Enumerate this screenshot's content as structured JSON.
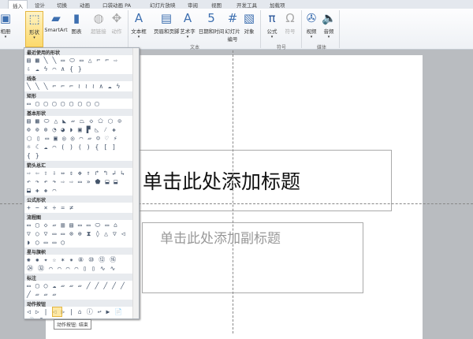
{
  "tabs": [
    "插入",
    "设计",
    "切换",
    "动画",
    "口袋动画 PA",
    "幻灯片放映",
    "审阅",
    "视图",
    "开发工具",
    "加载项"
  ],
  "ribbon": {
    "items": [
      {
        "label": "相册",
        "icon": "photo-album-icon",
        "glyph": "▣"
      },
      {
        "label": "形状",
        "icon": "shapes-icon",
        "glyph": "⬚"
      },
      {
        "label": "SmartArt",
        "icon": "smartart-icon",
        "glyph": "▰"
      },
      {
        "label": "图表",
        "icon": "chart-icon",
        "glyph": "▮"
      },
      {
        "label": "超链接",
        "icon": "hyperlink-icon",
        "glyph": "◍"
      },
      {
        "label": "动作",
        "icon": "action-icon",
        "glyph": "✥"
      },
      {
        "label": "文本框",
        "icon": "textbox-icon",
        "glyph": "A"
      },
      {
        "label": "页眉和页脚",
        "icon": "header-footer-icon",
        "glyph": "▤"
      },
      {
        "label": "艺术字",
        "icon": "wordart-icon",
        "glyph": "A"
      },
      {
        "label": "日期和时间",
        "icon": "date-time-icon",
        "glyph": "5"
      },
      {
        "label": "幻灯片\n编号",
        "icon": "slide-number-icon",
        "glyph": "#"
      },
      {
        "label": "对象",
        "icon": "object-icon",
        "glyph": "▧"
      },
      {
        "label": "公式",
        "icon": "equation-icon",
        "glyph": "π"
      },
      {
        "label": "符号",
        "icon": "symbol-icon",
        "glyph": "Ω"
      },
      {
        "label": "视频",
        "icon": "video-icon",
        "glyph": "✇"
      },
      {
        "label": "音频",
        "icon": "audio-icon",
        "glyph": "🔈"
      }
    ],
    "groups": [
      "文本",
      "符号",
      "媒体"
    ]
  },
  "gallery": {
    "sections": [
      {
        "title": "最近使用的形状",
        "shapes": "▤▦╲╲▭⬭▭△⌐⌐⇨⇩☁ϟ⌒∧{}"
      },
      {
        "title": "线条",
        "shapes": "╲╲╲⌐⌐⌐≀≀≀∧☁ϟ"
      },
      {
        "title": "矩形",
        "shapes": "▭▢▢▢▢▢▢▢▢"
      },
      {
        "title": "基本形状",
        "shapes": "▤▦⬭△◣▱⏢◇⬠⬡⊙⊚⊚⊚◔◕◗▣▛◺⁄✚⬡▯▭▣◎◎⌒▱☺♡⚡☼☾☁⌒()(){[]{}"
      },
      {
        "title": "箭头总汇",
        "shapes": "⇨⇦⇧⇩⇔⇕✥⇑↱↰↲↳↶↷↶↷⇨⇨▭»⬟⬓⬓⬓✚✚⌒"
      },
      {
        "title": "公式形状",
        "shapes": "+−×÷=≠"
      },
      {
        "title": "流程图",
        "shapes": "▭▢◇▱▥▤▭▭⬭▭⌂▽○▽▭▭⊗⊕⧗◊△▽◁◗◯▭▭◯"
      },
      {
        "title": "星与旗帜",
        "shapes": "✺✹✦☆✶✷⑧⑩⑫⑯㉔㉜⌒⌒⌒⌒▯▯∿∿"
      },
      {
        "title": "标注",
        "shapes": "▭▢◯☁▱▱▱╱╱╱╱╱╱▱▱▱"
      },
      {
        "title": "动作按钮",
        "shapes": "◁▷|◁▷|⌂ⓘ↩▶📄🔊?▭"
      }
    ]
  },
  "slide": {
    "title": "单击此处添加标题",
    "subtitle": "单击此处添加副标题"
  },
  "tooltip": "动作按钮: 结束"
}
